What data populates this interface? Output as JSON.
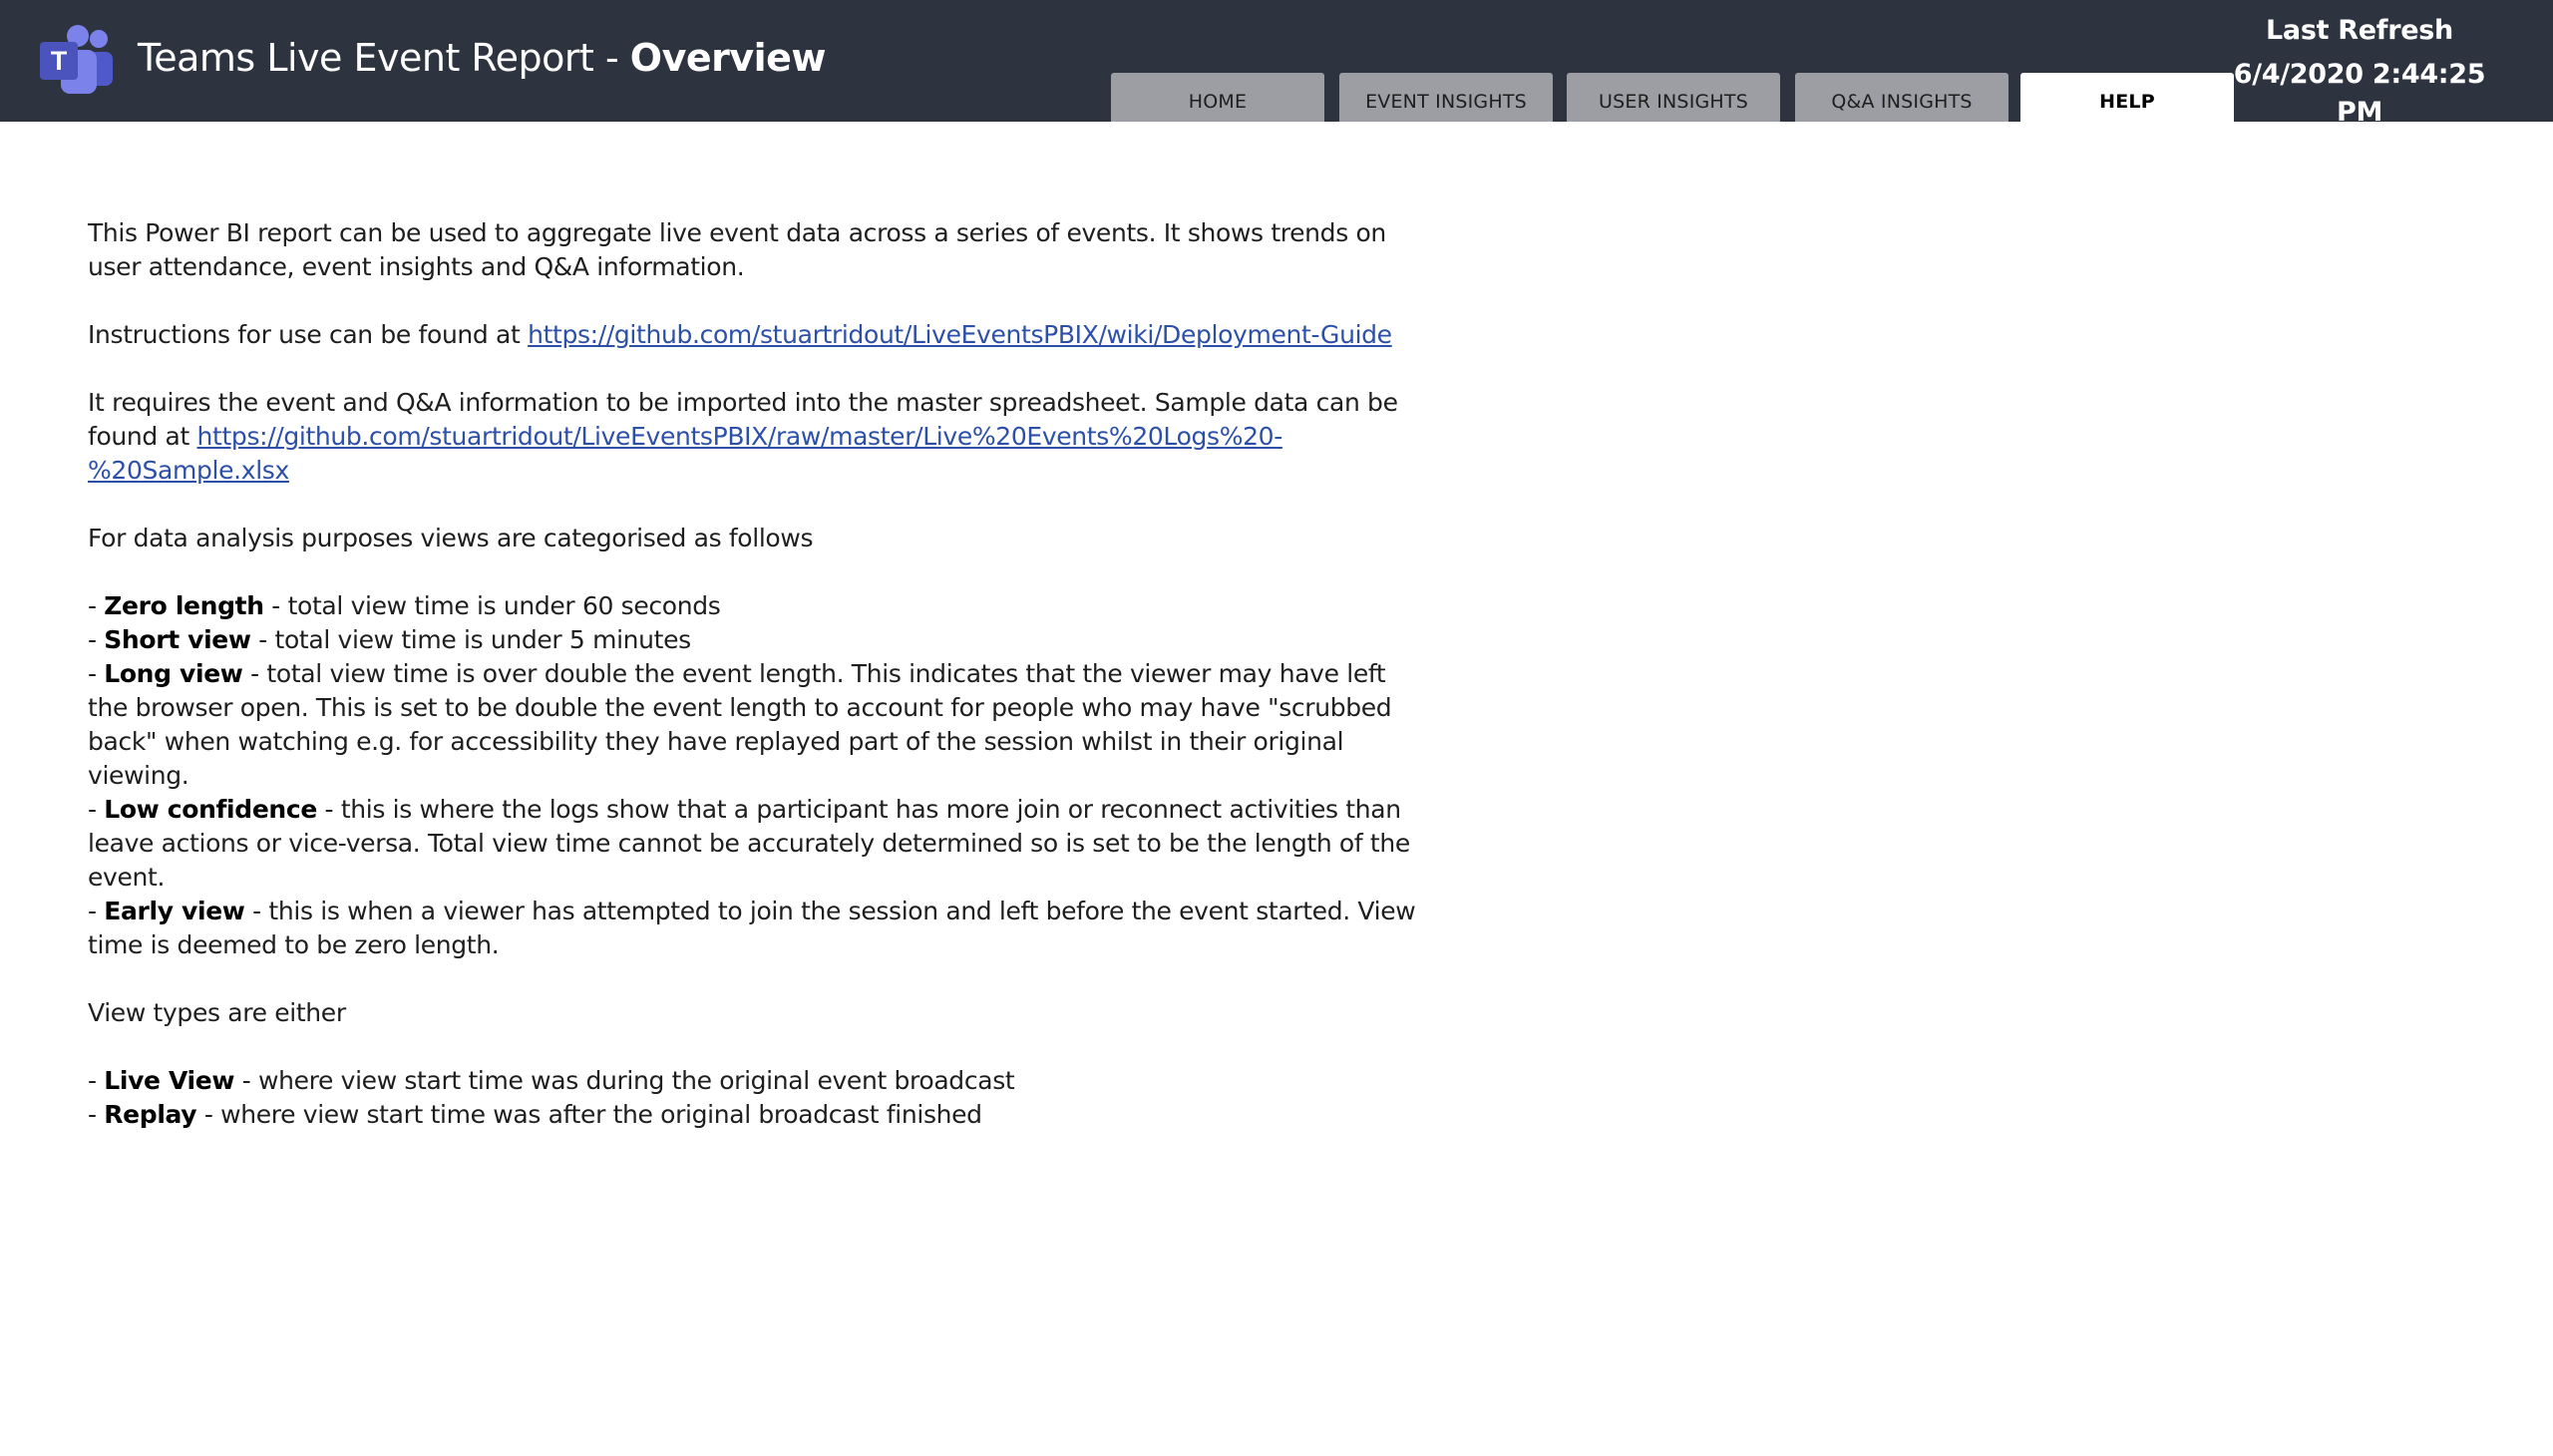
{
  "header": {
    "title_prefix": "Teams Live Event Report - ",
    "title_bold": "Overview",
    "logo_icon": "microsoft-teams-logo-icon",
    "colors": {
      "background": "#2d333f",
      "accent": "#5b5fc7"
    }
  },
  "refresh": {
    "label": "Last Refresh",
    "value": "6/4/2020 2:44:25 PM"
  },
  "tabs": [
    {
      "label": "HOME",
      "active": false
    },
    {
      "label": "EVENT INSIGHTS",
      "active": false
    },
    {
      "label": "USER INSIGHTS",
      "active": false
    },
    {
      "label": "Q&A INSIGHTS",
      "active": false
    },
    {
      "label": "HELP",
      "active": true
    }
  ],
  "content": {
    "intro": "This Power BI report can be used to aggregate live event data across a series of events.  It shows trends on user attendance, event insights and Q&A information.",
    "instructions_prefix": "Instructions for use can be found at ",
    "instructions_link": "https://github.com/stuartridout/LiveEventsPBIX/wiki/Deployment-Guide",
    "requires_text": "It requires the event and Q&A information to be imported into the master spreadsheet.  Sample data can be found at ",
    "sample_link": "https://github.com/stuartridout/LiveEventsPBIX/raw/master/Live%20Events%20Logs%20-%20Sample.xlsx",
    "categories_intro": "For data analysis purposes views are categorised as follows",
    "categories": [
      {
        "term": "Zero length",
        "desc": " - total view time is under 60 seconds"
      },
      {
        "term": "Short view",
        "desc": " - total view time is under 5 minutes"
      },
      {
        "term": "Long view",
        "desc": " - total view time is over double the event length.  This indicates that the viewer may have left the browser open.  This is set to be double the event length to account for people who may have \"scrubbed back\" when watching e.g. for accessibility they have replayed part of the session whilst in their original viewing."
      },
      {
        "term": "Low confidence",
        "desc": " - this is where the logs show that a participant has more join or reconnect activities than leave actions or vice-versa.  Total view time cannot be accurately determined so is set to be the length of the event."
      },
      {
        "term": "Early view",
        "desc": " - this is when a viewer has attempted to join the session and left before the event started.  View time is deemed to be zero length."
      }
    ],
    "view_types_intro": "View types are either",
    "view_types": [
      {
        "term": "Live View",
        "desc": " - where view start time was during the original event broadcast"
      },
      {
        "term": "Replay",
        "desc": " - where view start time was after the original broadcast finished"
      }
    ]
  }
}
